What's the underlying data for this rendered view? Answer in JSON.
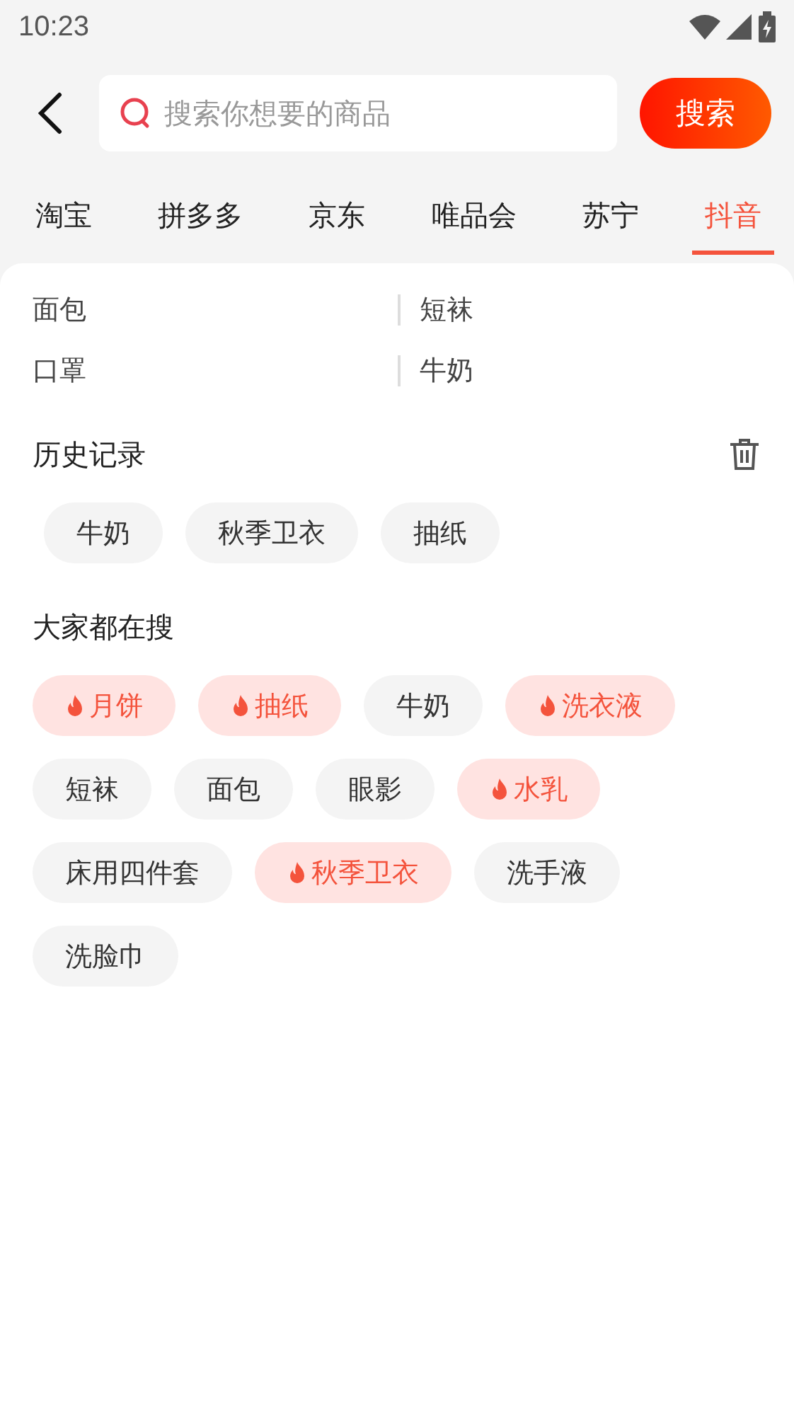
{
  "status_bar": {
    "time": "10:23"
  },
  "search": {
    "placeholder": "搜索你想要的商品",
    "button": "搜索"
  },
  "tabs": [
    {
      "label": "淘宝",
      "selected": false
    },
    {
      "label": "拼多多",
      "selected": false
    },
    {
      "label": "京东",
      "selected": false
    },
    {
      "label": "唯品会",
      "selected": false
    },
    {
      "label": "苏宁",
      "selected": false
    },
    {
      "label": "抖音",
      "selected": true
    }
  ],
  "suggestions": [
    "面包",
    "短袜",
    "口罩",
    "牛奶"
  ],
  "history": {
    "title": "历史记录",
    "items": [
      "牛奶",
      "秋季卫衣",
      "抽纸"
    ]
  },
  "popular": {
    "title": "大家都在搜",
    "items": [
      {
        "label": "月饼",
        "hot": true
      },
      {
        "label": "抽纸",
        "hot": true
      },
      {
        "label": "牛奶",
        "hot": false
      },
      {
        "label": "洗衣液",
        "hot": true
      },
      {
        "label": "短袜",
        "hot": false
      },
      {
        "label": "面包",
        "hot": false
      },
      {
        "label": "眼影",
        "hot": false
      },
      {
        "label": "水乳",
        "hot": true
      },
      {
        "label": "床用四件套",
        "hot": false
      },
      {
        "label": "秋季卫衣",
        "hot": true
      },
      {
        "label": "洗手液",
        "hot": false
      },
      {
        "label": "洗脸巾",
        "hot": false
      }
    ]
  }
}
